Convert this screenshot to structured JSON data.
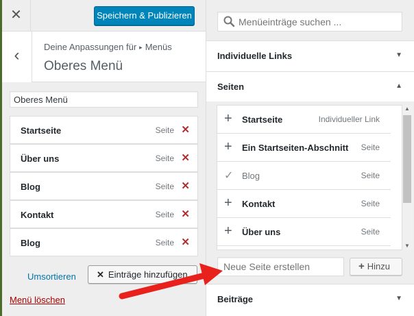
{
  "header": {
    "close_icon": "close-icon",
    "publish_label": "Speichern & Publizieren",
    "accent": "#0085ba"
  },
  "section": {
    "breadcrumb_prefix": "Deine Anpassungen für",
    "breadcrumb_target": "Menüs",
    "title": "Oberes Menü"
  },
  "menu": {
    "name_value": "Oberes Menü",
    "items": [
      {
        "title": "Startseite",
        "type": "Seite"
      },
      {
        "title": "Über uns",
        "type": "Seite"
      },
      {
        "title": "Blog",
        "type": "Seite"
      },
      {
        "title": "Kontakt",
        "type": "Seite"
      },
      {
        "title": "Blog",
        "type": "Seite"
      }
    ],
    "reorder_label": "Umsortieren",
    "add_items_label": "Einträge hinzufügen",
    "delete_label": "Menü löschen"
  },
  "available": {
    "search_placeholder": "Menüeinträge suchen ...",
    "sections": {
      "custom_links": "Individuelle Links",
      "pages": "Seiten",
      "posts": "Beiträge"
    },
    "pages": [
      {
        "title": "Startseite",
        "type": "Individueller Link",
        "added": false
      },
      {
        "title": "Ein Startseiten-Abschnitt",
        "type": "Seite",
        "added": false
      },
      {
        "title": "Blog",
        "type": "Seite",
        "added": true
      },
      {
        "title": "Kontakt",
        "type": "Seite",
        "added": false
      },
      {
        "title": "Über uns",
        "type": "Seite",
        "added": false
      }
    ],
    "new_page_placeholder": "Neue Seite erstellen",
    "add_button_label": "Hinzu"
  },
  "annotation_color": "#e8211d"
}
